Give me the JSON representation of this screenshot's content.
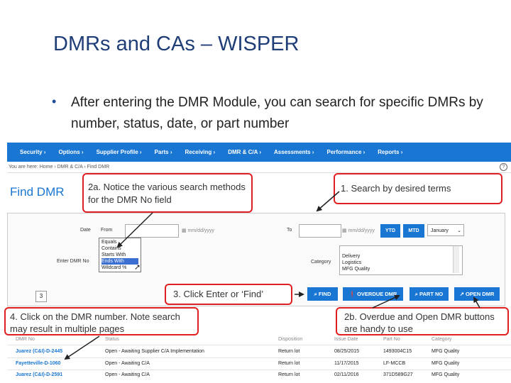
{
  "slide": {
    "title": "DMRs and CAs – WISPER",
    "bullet": "After entering the DMR Module, you can search for specific DMRs by number, status, date, or part number"
  },
  "nav": {
    "items": [
      "Security ›",
      "Options ›",
      "Supplier Profile ›",
      "Parts ›",
      "Receiving ›",
      "DMR & C/A ›",
      "Assessments ›",
      "Performance ›",
      "Reports ›"
    ]
  },
  "breadcrumb": "You are here:  Home  ›  DMR & C/A  ›  Find DMR",
  "help_icon": "?",
  "page_heading": "Find DMR",
  "form": {
    "date_label": "Date",
    "from_label": "From",
    "to_label": "To",
    "date_placeholder": "mm/dd/yyyy",
    "ytd": "YTD",
    "mtd": "MTD",
    "month_selected": "January",
    "enter_dmr_label": "Enter DMR No",
    "category_label": "Category",
    "dmr_no_options": [
      "Equals",
      "Contains",
      "Starts With",
      "Ends With",
      "Wildcard %"
    ],
    "dmr_no_highlighted_index": 3,
    "category_options": [
      "Delivery",
      "Logistics",
      "MFG Quality"
    ],
    "count": "3"
  },
  "actions": {
    "find": "FIND",
    "overdue": "OVERDUE DMR",
    "part_no": "PART NO",
    "open": "OPEN DMR"
  },
  "callouts": {
    "c2a": "2a. Notice the various search methods for the DMR No field",
    "c1": "1. Search by desired terms",
    "c3": "3. Click Enter or  ‘Find’",
    "c4": "4. Click on the DMR number. Note search may result in multiple pages",
    "c2b": "2b. Overdue and Open DMR buttons are handy to use"
  },
  "table": {
    "headers": [
      "DMR No",
      "Status",
      "Disposition",
      "Issue Date",
      "Part No",
      "Category"
    ],
    "rows": [
      [
        "Juarez (C&I)-D-2445",
        "Open - Awaiting Supplier C/A Implementation",
        "Return lot",
        "08/25/2015",
        "1493004C15",
        "MFG Quality"
      ],
      [
        "Fayetteville-D-1060",
        "Open - Awaiting C/A",
        "Return lot",
        "11/17/2015",
        "LF-MCCB",
        "MFG Quality"
      ],
      [
        "Juarez (C&I)-D-2591",
        "Open - Awaiting C/A",
        "Return lot",
        "02/11/2016",
        "371D589G27",
        "MFG Quality"
      ]
    ]
  },
  "colors": {
    "title": "#1f3e78",
    "nav": "#1976d2",
    "callout_border": "#e02020",
    "link": "#1976d2"
  }
}
